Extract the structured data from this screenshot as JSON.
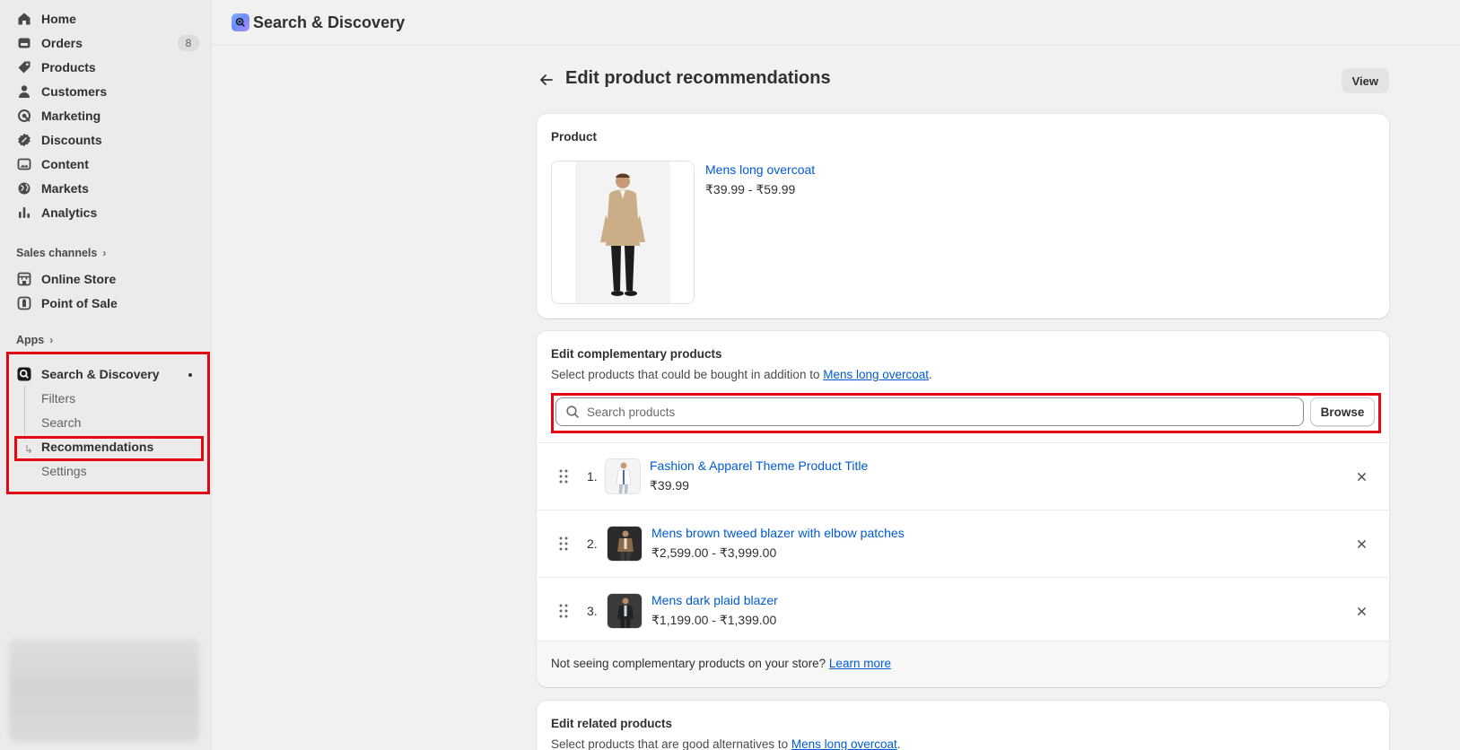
{
  "sidebar": {
    "items": [
      {
        "label": "Home",
        "icon": "home-icon"
      },
      {
        "label": "Orders",
        "icon": "orders-icon",
        "badge": "8"
      },
      {
        "label": "Products",
        "icon": "tag-icon"
      },
      {
        "label": "Customers",
        "icon": "person-icon"
      },
      {
        "label": "Marketing",
        "icon": "target-icon"
      },
      {
        "label": "Discounts",
        "icon": "discount-icon"
      },
      {
        "label": "Content",
        "icon": "image-icon"
      },
      {
        "label": "Markets",
        "icon": "globe-icon"
      },
      {
        "label": "Analytics",
        "icon": "chart-icon"
      }
    ],
    "sales_channels_label": "Sales channels",
    "channels": [
      {
        "label": "Online Store",
        "icon": "store-icon"
      },
      {
        "label": "Point of Sale",
        "icon": "pos-icon"
      }
    ],
    "apps_label": "Apps",
    "app": {
      "label": "Search & Discovery",
      "subitems": [
        "Filters",
        "Search",
        "Recommendations",
        "Settings"
      ],
      "active": "Recommendations"
    }
  },
  "topbar": {
    "title": "Search & Discovery"
  },
  "page": {
    "title": "Edit product recommendations",
    "view_label": "View"
  },
  "product_card": {
    "title": "Product",
    "product_name": "Mens long overcoat",
    "product_price": "₹39.99 - ₹59.99"
  },
  "complementary": {
    "title": "Edit complementary products",
    "desc_prefix": "Select products that could be bought in addition to ",
    "desc_link": "Mens long overcoat",
    "desc_suffix": ".",
    "search_placeholder": "Search products",
    "browse_label": "Browse",
    "rows": [
      {
        "num": "1.",
        "name": "Fashion & Apparel Theme Product Title",
        "price": "₹39.99"
      },
      {
        "num": "2.",
        "name": "Mens brown tweed blazer with elbow patches",
        "price": "₹2,599.00 - ₹3,999.00"
      },
      {
        "num": "3.",
        "name": "Mens dark plaid blazer",
        "price": "₹1,199.00 - ₹1,399.00"
      }
    ],
    "footer_text": "Not seeing complementary products on your store? ",
    "footer_link": "Learn more"
  },
  "related": {
    "title": "Edit related products",
    "desc_prefix": "Select products that are good alternatives to ",
    "desc_link": "Mens long overcoat",
    "desc_suffix": "."
  },
  "colors": {
    "highlight": "#e30613",
    "link": "#005bd3",
    "sidebar_bg": "#ebebeb",
    "page_bg": "#f1f1f1"
  }
}
